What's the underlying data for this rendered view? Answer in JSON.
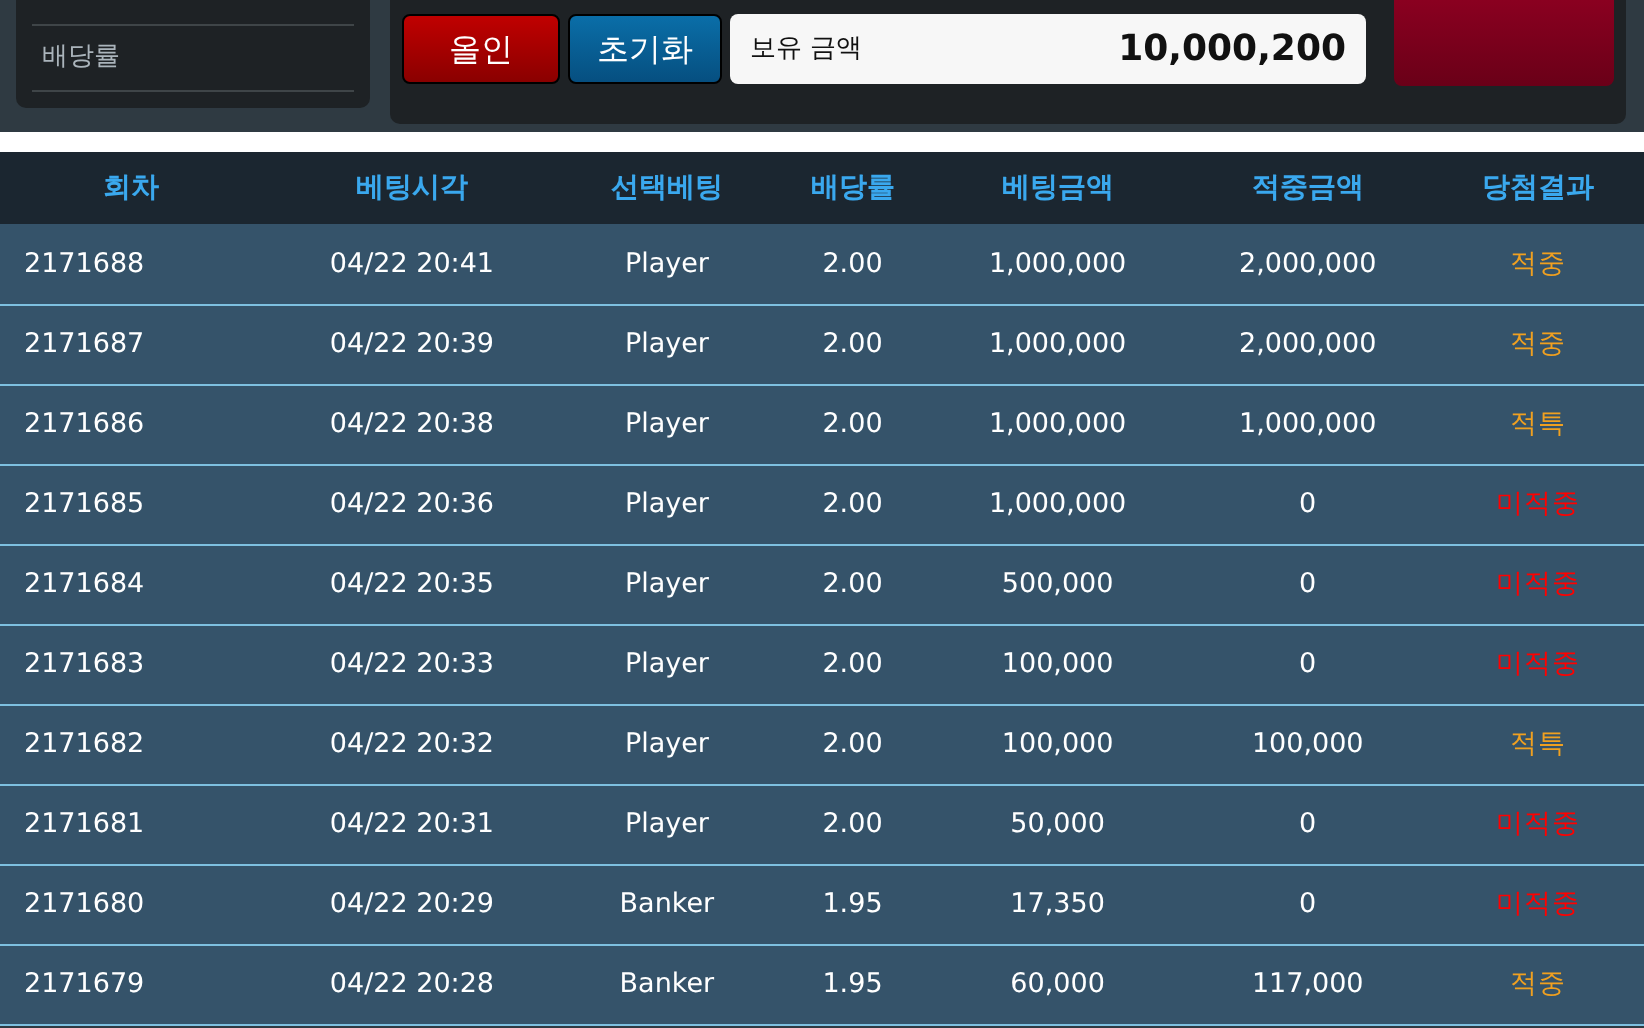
{
  "sidebar": {
    "items": [
      {
        "label": "배당률"
      }
    ]
  },
  "actions": {
    "buttons": [
      {
        "label": "올인",
        "kind": "allin"
      },
      {
        "label": "초기화",
        "kind": "reset"
      }
    ],
    "balance": {
      "label": "보유 금액",
      "value": "10,000,200"
    }
  },
  "table": {
    "columns": [
      "회차",
      "베팅시각",
      "선택베팅",
      "배당률",
      "베팅금액",
      "적중금액",
      "당첨결과"
    ],
    "rows": [
      {
        "cells": [
          "2171688",
          "04/22 20:41",
          "Player",
          "2.00",
          "1,000,000",
          "2,000,000"
        ],
        "result": "적중",
        "color": "#f0a020"
      },
      {
        "cells": [
          "2171687",
          "04/22 20:39",
          "Player",
          "2.00",
          "1,000,000",
          "2,000,000"
        ],
        "result": "적중",
        "color": "#f0a020"
      },
      {
        "cells": [
          "2171686",
          "04/22 20:38",
          "Player",
          "2.00",
          "1,000,000",
          "1,000,000"
        ],
        "result": "적특",
        "color": "#f0a020"
      },
      {
        "cells": [
          "2171685",
          "04/22 20:36",
          "Player",
          "2.00",
          "1,000,000",
          "0"
        ],
        "result": "미적중",
        "color": "#ff0000"
      },
      {
        "cells": [
          "2171684",
          "04/22 20:35",
          "Player",
          "2.00",
          "500,000",
          "0"
        ],
        "result": "미적중",
        "color": "#ff0000"
      },
      {
        "cells": [
          "2171683",
          "04/22 20:33",
          "Player",
          "2.00",
          "100,000",
          "0"
        ],
        "result": "미적중",
        "color": "#ff0000"
      },
      {
        "cells": [
          "2171682",
          "04/22 20:32",
          "Player",
          "2.00",
          "100,000",
          "100,000"
        ],
        "result": "적특",
        "color": "#f0a020"
      },
      {
        "cells": [
          "2171681",
          "04/22 20:31",
          "Player",
          "2.00",
          "50,000",
          "0"
        ],
        "result": "미적중",
        "color": "#ff0000"
      },
      {
        "cells": [
          "2171680",
          "04/22 20:29",
          "Banker",
          "1.95",
          "17,350",
          "0"
        ],
        "result": "미적중",
        "color": "#ff0000"
      },
      {
        "cells": [
          "2171679",
          "04/22 20:28",
          "Banker",
          "1.95",
          "60,000",
          "117,000"
        ],
        "result": "적중",
        "color": "#f0a020"
      }
    ]
  }
}
